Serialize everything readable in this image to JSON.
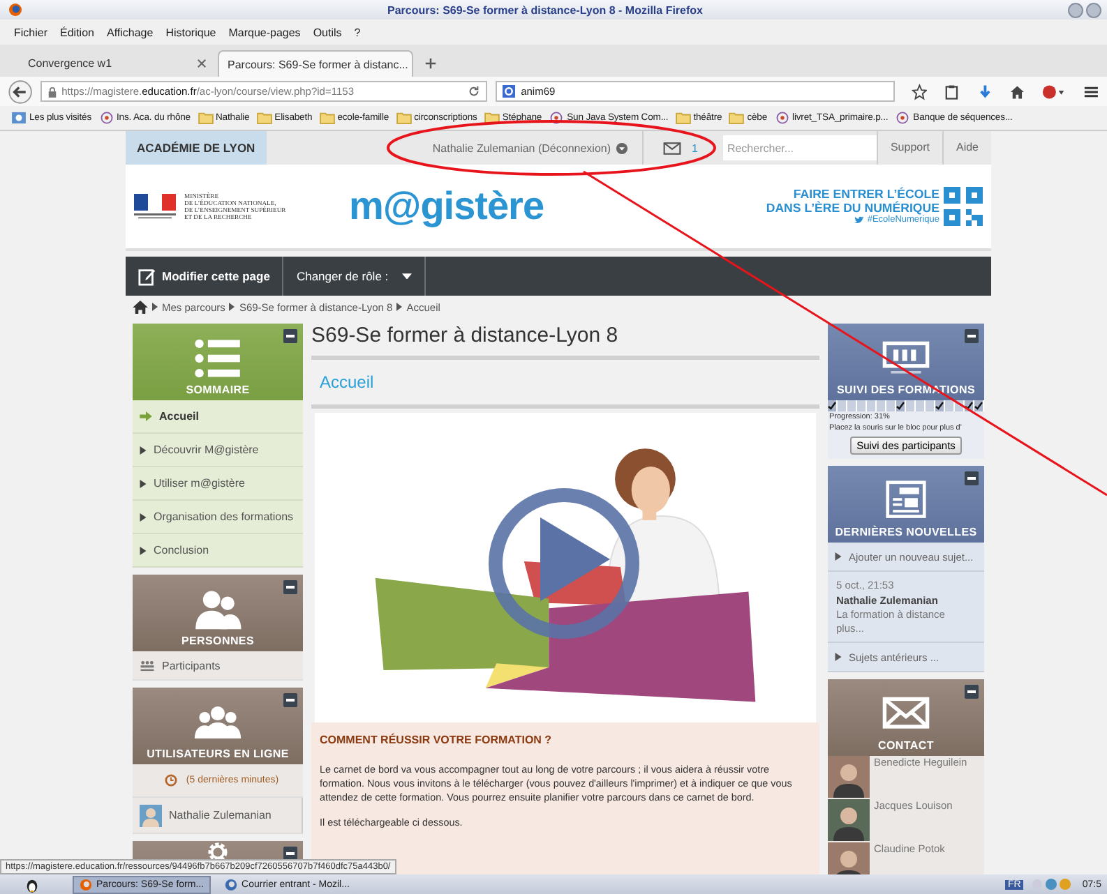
{
  "window": {
    "title": "Parcours: S69-Se former à distance-Lyon 8 - Mozilla Firefox"
  },
  "menu": [
    "Fichier",
    "Édition",
    "Affichage",
    "Historique",
    "Marque-pages",
    "Outils",
    "?"
  ],
  "tabs": [
    {
      "label": "Convergence w1",
      "selected": false
    },
    {
      "label": "Parcours: S69-Se former à distanc...",
      "selected": true
    }
  ],
  "address": {
    "url": "https://magistere.**education.fr**/ac-lyon/course/view.php?id=1153",
    "search": "anim69"
  },
  "bookmarks": [
    {
      "label": "Les plus visités",
      "kind": "special"
    },
    {
      "label": "Ins. Aca. du rhône",
      "kind": "site"
    },
    {
      "label": "Nathalie",
      "kind": "folder"
    },
    {
      "label": "Elisabeth",
      "kind": "folder"
    },
    {
      "label": "ecole-famille",
      "kind": "folder"
    },
    {
      "label": "circonscriptions",
      "kind": "folder"
    },
    {
      "label": "Stéphane",
      "kind": "folder"
    },
    {
      "label": "Sun Java System Com...",
      "kind": "site"
    },
    {
      "label": "théâtre",
      "kind": "folder"
    },
    {
      "label": "cèbe",
      "kind": "folder"
    },
    {
      "label": "livret_TSA_primaire.p...",
      "kind": "site"
    },
    {
      "label": "Banque de séquences...",
      "kind": "site"
    }
  ],
  "site_bar": {
    "academy": "ACADÉMIE DE LYON",
    "user": "Nathalie Zulemanian (Déconnexion)",
    "messages": "1",
    "search_placeholder": "Rechercher...",
    "links": [
      "Support",
      "Aide"
    ]
  },
  "header": {
    "ministry": [
      "MINISTÈRE",
      "DE L’ÉDUCATION NATIONALE,",
      "DE L’ENSEIGNEMENT SUPÉRIEUR",
      "ET DE LA RECHERCHE"
    ],
    "logo": "m@gistère",
    "slogan": [
      "FAIRE ENTRER L’ÉCOLE",
      "DANS L’ÈRE DU NUMÉRIQUE"
    ],
    "hashtag": "#EcoleNumerique"
  },
  "toolbar": {
    "edit": "Modifier cette page",
    "role": "Changer de rôle :"
  },
  "breadcrumb": [
    "Mes parcours",
    "S69-Se former à distance-Lyon 8",
    "Accueil"
  ],
  "left_blocks": [
    {
      "kind": "menu",
      "title": "SOMMAIRE",
      "items": [
        {
          "label": "Accueil",
          "kind": "nav",
          "selected": true
        },
        {
          "label": "Découvrir M@gistère",
          "kind": "nav",
          "selected": false
        },
        {
          "label": "Utiliser m@gistère",
          "kind": "nav",
          "selected": false
        },
        {
          "label": "Organisation des formations",
          "kind": "nav",
          "selected": false
        },
        {
          "label": "Conclusion",
          "kind": "nav",
          "selected": false
        }
      ]
    },
    {
      "kind": "people",
      "title": "PERSONNES",
      "items": [
        {
          "label": "Participants",
          "kind": "participants"
        }
      ]
    },
    {
      "kind": "users",
      "title": "UTILISATEURS EN LIGNE",
      "items": [
        {
          "label": "(5 dernières minutes)",
          "kind": "clock"
        },
        {
          "label": "Nathalie Zulemanian",
          "kind": "user"
        }
      ]
    },
    {
      "kind": "settings"
    }
  ],
  "center": {
    "title": "S69-Se former à distance-Lyon 8",
    "section": "Accueil",
    "info": {
      "heading": "COMMENT RÉUSSIR VOTRE FORMATION ?",
      "paragraphs": [
        "Le carnet de bord va vous accompagner tout au long de votre parcours ; il vous aidera à réussir votre formation. Nous vous invitons à le télécharger (vous pouvez d'ailleurs l'imprimer) et à indiquer ce que vous attendez de cette formation. Vous pourrez ensuite planifier votre parcours dans ce carnet de bord.",
        "Il est téléchargeable ci dessous."
      ]
    }
  },
  "right_blocks": [
    {
      "kind": "progress",
      "title": "SUIVI DES FORMATIONS",
      "segments": [
        {
          "done": true
        },
        {
          "done": false
        },
        {
          "done": false
        },
        {
          "done": false
        },
        {
          "done": false
        },
        {
          "done": false
        },
        {
          "done": false
        },
        {
          "done": true
        },
        {
          "done": false
        },
        {
          "done": false
        },
        {
          "done": false
        },
        {
          "done": true
        },
        {
          "done": false
        },
        {
          "done": false
        },
        {
          "done": true
        },
        {
          "done": true
        }
      ],
      "progress": "Progression: 31%",
      "hint": "Placez la souris sur le bloc pour plus d'",
      "button": "Suivi des participants"
    },
    {
      "kind": "news",
      "title": "DERNIÈRES NOUVELLES",
      "add": "Ajouter un nouveau sujet...",
      "date": "5 oct., 21:53",
      "author": "Nathalie Zulemanian",
      "excerpt": "La formation à distance plus...",
      "older": "Sujets antérieurs ..."
    },
    {
      "kind": "contact",
      "title": "CONTACT",
      "people": [
        "Benedicte Heguilein",
        "Jacques Louison",
        "Claudine Potok"
      ]
    }
  ],
  "status_url": "https://magistere.education.fr/ressources/94496fb7b667b209cf7260556707b7f460dfc75a443b0/",
  "taskbar": {
    "tasks": [
      {
        "label": "Parcours: S69-Se form...",
        "selected": true
      },
      {
        "label": "Courrier entrant - Mozil...",
        "selected": false
      }
    ],
    "lang": "FR",
    "clock": "07:5"
  }
}
